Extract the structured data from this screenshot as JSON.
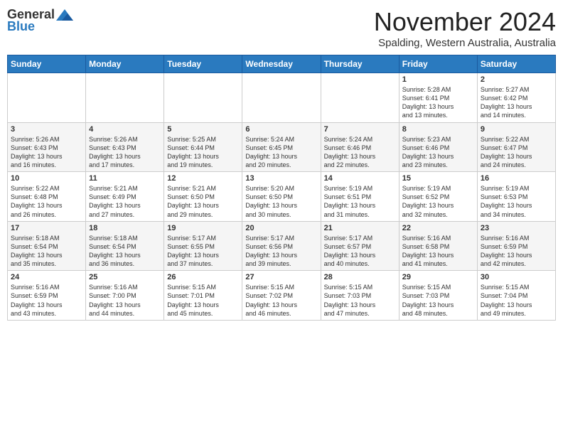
{
  "header": {
    "logo_general": "General",
    "logo_blue": "Blue",
    "month_title": "November 2024",
    "location": "Spalding, Western Australia, Australia"
  },
  "columns": [
    "Sunday",
    "Monday",
    "Tuesday",
    "Wednesday",
    "Thursday",
    "Friday",
    "Saturday"
  ],
  "weeks": [
    [
      {
        "day": "",
        "info": ""
      },
      {
        "day": "",
        "info": ""
      },
      {
        "day": "",
        "info": ""
      },
      {
        "day": "",
        "info": ""
      },
      {
        "day": "",
        "info": ""
      },
      {
        "day": "1",
        "info": "Sunrise: 5:28 AM\nSunset: 6:41 PM\nDaylight: 13 hours\nand 13 minutes."
      },
      {
        "day": "2",
        "info": "Sunrise: 5:27 AM\nSunset: 6:42 PM\nDaylight: 13 hours\nand 14 minutes."
      }
    ],
    [
      {
        "day": "3",
        "info": "Sunrise: 5:26 AM\nSunset: 6:43 PM\nDaylight: 13 hours\nand 16 minutes."
      },
      {
        "day": "4",
        "info": "Sunrise: 5:26 AM\nSunset: 6:43 PM\nDaylight: 13 hours\nand 17 minutes."
      },
      {
        "day": "5",
        "info": "Sunrise: 5:25 AM\nSunset: 6:44 PM\nDaylight: 13 hours\nand 19 minutes."
      },
      {
        "day": "6",
        "info": "Sunrise: 5:24 AM\nSunset: 6:45 PM\nDaylight: 13 hours\nand 20 minutes."
      },
      {
        "day": "7",
        "info": "Sunrise: 5:24 AM\nSunset: 6:46 PM\nDaylight: 13 hours\nand 22 minutes."
      },
      {
        "day": "8",
        "info": "Sunrise: 5:23 AM\nSunset: 6:46 PM\nDaylight: 13 hours\nand 23 minutes."
      },
      {
        "day": "9",
        "info": "Sunrise: 5:22 AM\nSunset: 6:47 PM\nDaylight: 13 hours\nand 24 minutes."
      }
    ],
    [
      {
        "day": "10",
        "info": "Sunrise: 5:22 AM\nSunset: 6:48 PM\nDaylight: 13 hours\nand 26 minutes."
      },
      {
        "day": "11",
        "info": "Sunrise: 5:21 AM\nSunset: 6:49 PM\nDaylight: 13 hours\nand 27 minutes."
      },
      {
        "day": "12",
        "info": "Sunrise: 5:21 AM\nSunset: 6:50 PM\nDaylight: 13 hours\nand 29 minutes."
      },
      {
        "day": "13",
        "info": "Sunrise: 5:20 AM\nSunset: 6:50 PM\nDaylight: 13 hours\nand 30 minutes."
      },
      {
        "day": "14",
        "info": "Sunrise: 5:19 AM\nSunset: 6:51 PM\nDaylight: 13 hours\nand 31 minutes."
      },
      {
        "day": "15",
        "info": "Sunrise: 5:19 AM\nSunset: 6:52 PM\nDaylight: 13 hours\nand 32 minutes."
      },
      {
        "day": "16",
        "info": "Sunrise: 5:19 AM\nSunset: 6:53 PM\nDaylight: 13 hours\nand 34 minutes."
      }
    ],
    [
      {
        "day": "17",
        "info": "Sunrise: 5:18 AM\nSunset: 6:54 PM\nDaylight: 13 hours\nand 35 minutes."
      },
      {
        "day": "18",
        "info": "Sunrise: 5:18 AM\nSunset: 6:54 PM\nDaylight: 13 hours\nand 36 minutes."
      },
      {
        "day": "19",
        "info": "Sunrise: 5:17 AM\nSunset: 6:55 PM\nDaylight: 13 hours\nand 37 minutes."
      },
      {
        "day": "20",
        "info": "Sunrise: 5:17 AM\nSunset: 6:56 PM\nDaylight: 13 hours\nand 39 minutes."
      },
      {
        "day": "21",
        "info": "Sunrise: 5:17 AM\nSunset: 6:57 PM\nDaylight: 13 hours\nand 40 minutes."
      },
      {
        "day": "22",
        "info": "Sunrise: 5:16 AM\nSunset: 6:58 PM\nDaylight: 13 hours\nand 41 minutes."
      },
      {
        "day": "23",
        "info": "Sunrise: 5:16 AM\nSunset: 6:59 PM\nDaylight: 13 hours\nand 42 minutes."
      }
    ],
    [
      {
        "day": "24",
        "info": "Sunrise: 5:16 AM\nSunset: 6:59 PM\nDaylight: 13 hours\nand 43 minutes."
      },
      {
        "day": "25",
        "info": "Sunrise: 5:16 AM\nSunset: 7:00 PM\nDaylight: 13 hours\nand 44 minutes."
      },
      {
        "day": "26",
        "info": "Sunrise: 5:15 AM\nSunset: 7:01 PM\nDaylight: 13 hours\nand 45 minutes."
      },
      {
        "day": "27",
        "info": "Sunrise: 5:15 AM\nSunset: 7:02 PM\nDaylight: 13 hours\nand 46 minutes."
      },
      {
        "day": "28",
        "info": "Sunrise: 5:15 AM\nSunset: 7:03 PM\nDaylight: 13 hours\nand 47 minutes."
      },
      {
        "day": "29",
        "info": "Sunrise: 5:15 AM\nSunset: 7:03 PM\nDaylight: 13 hours\nand 48 minutes."
      },
      {
        "day": "30",
        "info": "Sunrise: 5:15 AM\nSunset: 7:04 PM\nDaylight: 13 hours\nand 49 minutes."
      }
    ]
  ]
}
